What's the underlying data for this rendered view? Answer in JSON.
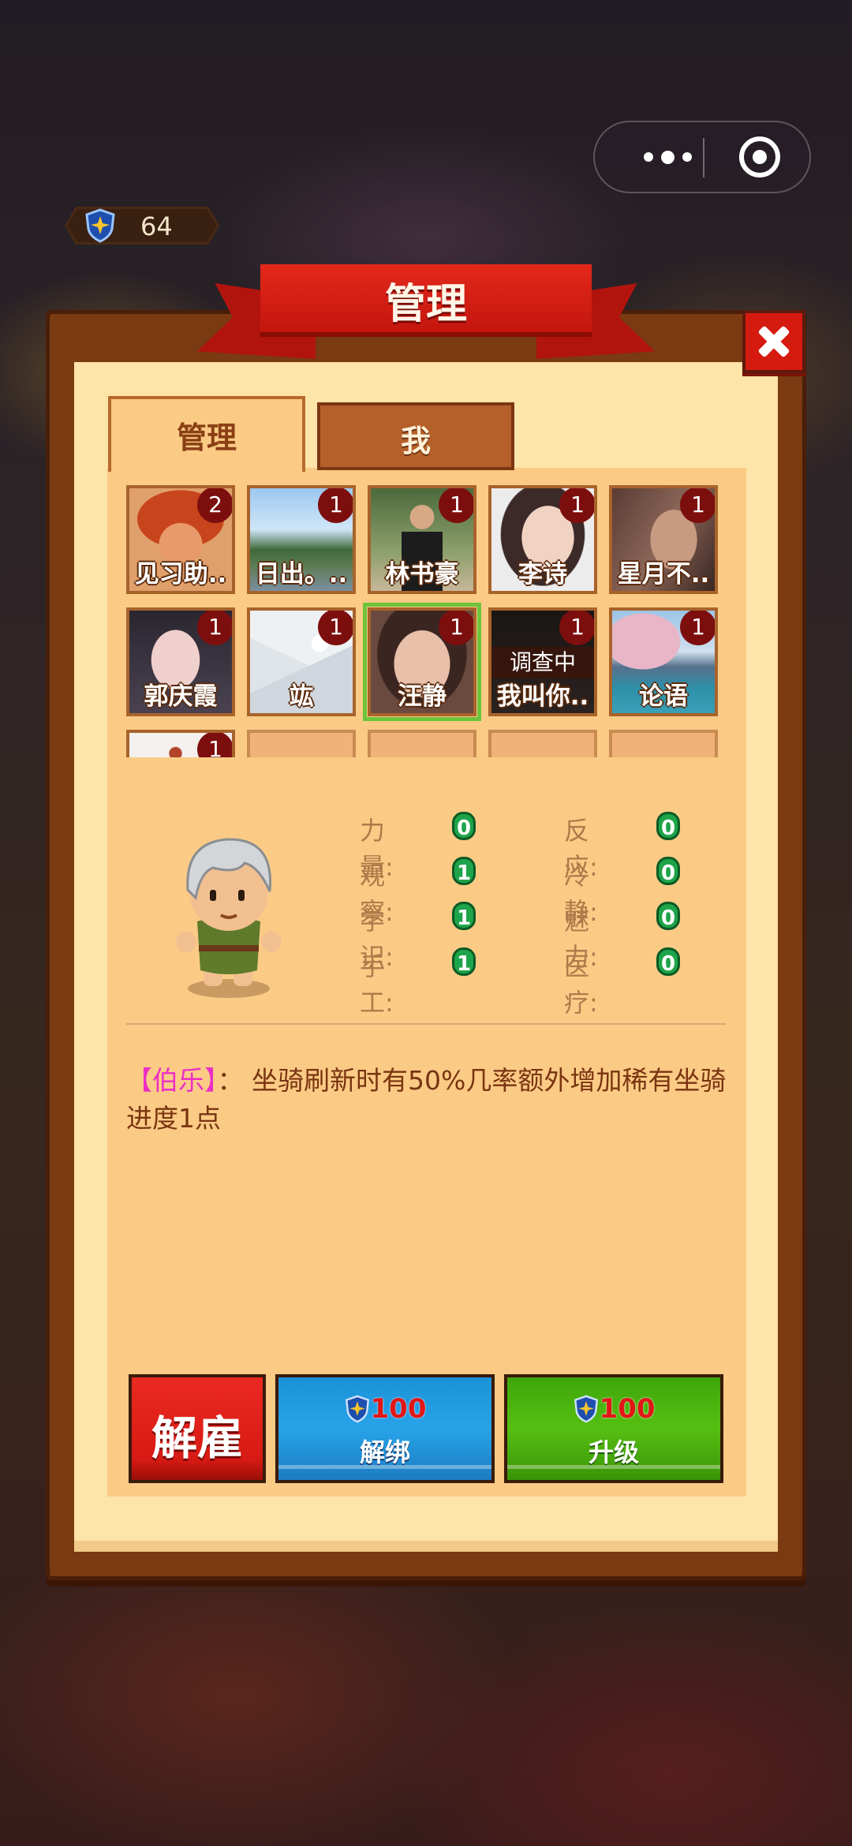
{
  "header": {
    "currency_value": "64",
    "title": "管理"
  },
  "tabs": [
    {
      "label": "管理",
      "active": true
    },
    {
      "label": "我",
      "active": false
    }
  ],
  "roster": [
    {
      "name": "见习助..",
      "level": "2"
    },
    {
      "name": "日出。..",
      "level": "1"
    },
    {
      "name": "林书豪",
      "level": "1"
    },
    {
      "name": "李诗",
      "level": "1"
    },
    {
      "name": "星月不..",
      "level": "1"
    },
    {
      "name": "郭庆霞",
      "level": "1"
    },
    {
      "name": "竑",
      "level": "1"
    },
    {
      "name": "汪静",
      "level": "1",
      "selected": true
    },
    {
      "name": "我叫你..",
      "level": "1",
      "status": "调查中"
    },
    {
      "name": "论语",
      "level": "1"
    },
    {
      "name": "",
      "level": "1"
    }
  ],
  "stats": [
    {
      "label": "力量:",
      "value": "0"
    },
    {
      "label": "观察:",
      "value": "1"
    },
    {
      "label": "学识:",
      "value": "1"
    },
    {
      "label": "手工:",
      "value": "1"
    },
    {
      "label": "反应:",
      "value": "0"
    },
    {
      "label": "冷静:",
      "value": "0"
    },
    {
      "label": "魅力:",
      "value": "0"
    },
    {
      "label": "医疗:",
      "value": "0"
    }
  ],
  "description": {
    "tag": "【伯乐】",
    "text": "： 坐骑刷新时有50%几率额外增加稀有坐骑进度1点"
  },
  "buttons": {
    "fire": "解雇",
    "unbind": {
      "cost": "100",
      "label": "解绑"
    },
    "upgrade": {
      "cost": "100",
      "label": "升级"
    }
  }
}
